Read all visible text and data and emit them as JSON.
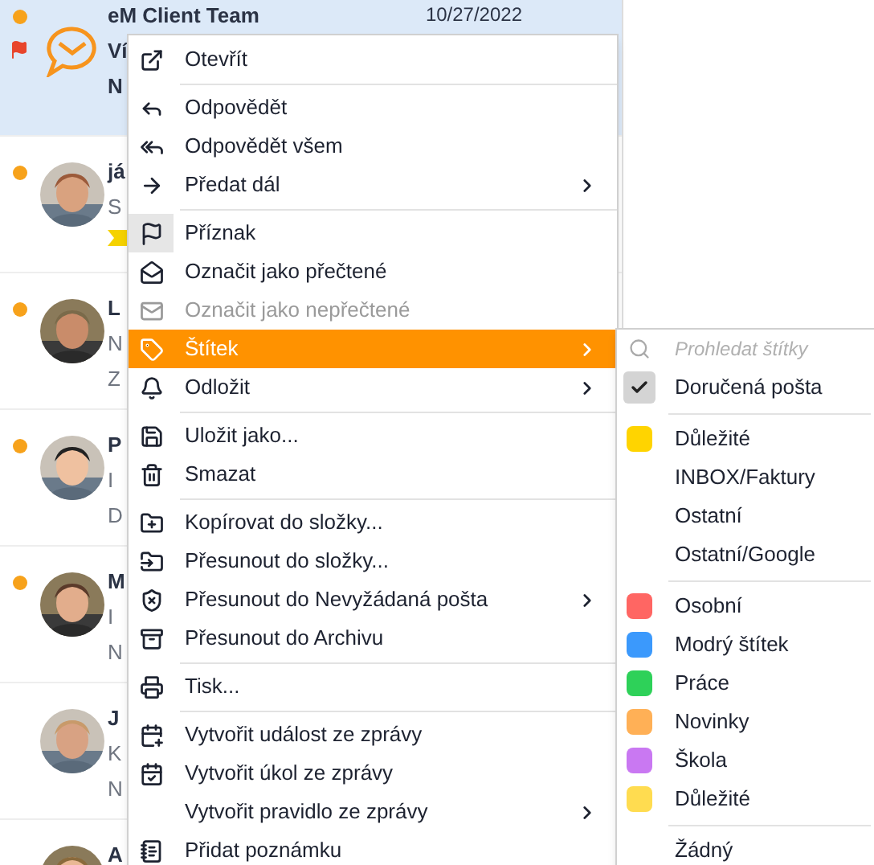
{
  "messages": [
    {
      "kind": "logo",
      "sender": "eM Client Team",
      "date": "10/27/2022",
      "line_2": "Ví",
      "line_3": "N",
      "selected": true,
      "unread": true,
      "flagged": true,
      "tagged": false
    },
    {
      "sender": "já",
      "line_2": "S",
      "selected": false,
      "unread": true,
      "flagged": false,
      "tagged": true
    },
    {
      "sender": "L",
      "line_2": "N",
      "line_3": "Z",
      "selected": false,
      "unread": true,
      "flagged": false,
      "tagged": false
    },
    {
      "sender": "P",
      "line_2": "I",
      "line_3": "D",
      "selected": false,
      "unread": true,
      "flagged": false,
      "tagged": false
    },
    {
      "sender": "M",
      "line_2": "I",
      "line_3": "N",
      "selected": false,
      "unread": true,
      "flagged": false,
      "tagged": false
    },
    {
      "sender": "J",
      "line_2": "K",
      "line_3": "N",
      "selected": false,
      "unread": false,
      "flagged": false,
      "tagged": false
    },
    {
      "sender": "A",
      "selected": false,
      "unread": false,
      "flagged": false,
      "tagged": false
    }
  ],
  "context_menu": [
    {
      "kind": "item",
      "label": "Otevřít",
      "selected": false
    },
    {
      "kind": "separator"
    },
    {
      "kind": "item",
      "label": "Odpovědět",
      "selected": false
    },
    {
      "kind": "item",
      "label": "Odpovědět všem",
      "selected": false
    },
    {
      "kind": "item",
      "label": "Předat dál",
      "selected": false,
      "submenu": true
    },
    {
      "kind": "separator"
    },
    {
      "kind": "item",
      "label": "Příznak",
      "selected": false,
      "checked": true
    },
    {
      "kind": "item",
      "label": "Označit jako přečtené",
      "selected": false
    },
    {
      "kind": "item",
      "label": "Označit jako nepřečtené",
      "selected": false,
      "disabled": true
    },
    {
      "kind": "item",
      "label": "Štítek",
      "selected": true,
      "submenu": true
    },
    {
      "kind": "item",
      "label": "Odložit",
      "selected": false,
      "submenu": true
    },
    {
      "kind": "separator"
    },
    {
      "kind": "item",
      "label": "Uložit jako...",
      "selected": false
    },
    {
      "kind": "item",
      "label": "Smazat",
      "selected": false
    },
    {
      "kind": "separator"
    },
    {
      "kind": "item",
      "label": "Kopírovat do složky...",
      "selected": false
    },
    {
      "kind": "item",
      "label": "Přesunout do složky...",
      "selected": false
    },
    {
      "kind": "item",
      "label": "Přesunout do Nevyžádaná pošta",
      "selected": false,
      "submenu": true
    },
    {
      "kind": "item",
      "label": "Přesunout do Archivu",
      "selected": false
    },
    {
      "kind": "separator"
    },
    {
      "kind": "item",
      "label": "Tisk...",
      "selected": false
    },
    {
      "kind": "separator"
    },
    {
      "kind": "item",
      "label": "Vytvořit událost ze zprávy",
      "selected": false
    },
    {
      "kind": "item",
      "label": "Vytvořit úkol ze zprávy",
      "selected": false
    },
    {
      "kind": "item",
      "label": "Vytvořit pravidlo ze zprávy",
      "selected": false,
      "submenu": true
    },
    {
      "kind": "item",
      "label": "Přidat poznámku",
      "selected": false
    }
  ],
  "tag_submenu": {
    "search": {
      "placeholder": "Prohledat štítky"
    },
    "items": [
      {
        "kind": "check",
        "label": "Doručená pošta",
        "checked": true
      },
      {
        "kind": "separator"
      },
      {
        "kind": "tag",
        "label": "Důležité",
        "color": "#ffd400"
      },
      {
        "kind": "tag",
        "label": "INBOX/Faktury"
      },
      {
        "kind": "tag",
        "label": "Ostatní"
      },
      {
        "kind": "tag",
        "label": "Ostatní/Google"
      },
      {
        "kind": "separator"
      },
      {
        "kind": "tag",
        "label": "Osobní",
        "color": "#ff6663"
      },
      {
        "kind": "tag",
        "label": "Modrý štítek",
        "color": "#3b99fc"
      },
      {
        "kind": "tag",
        "label": "Práce",
        "color": "#2ed159"
      },
      {
        "kind": "tag",
        "label": "Novinky",
        "color": "#ffb056"
      },
      {
        "kind": "tag",
        "label": "Škola",
        "color": "#c978f2"
      },
      {
        "kind": "tag",
        "label": "Důležité",
        "color": "#ffdc50"
      },
      {
        "kind": "separator"
      },
      {
        "kind": "plain",
        "label": "Žádný"
      }
    ]
  }
}
